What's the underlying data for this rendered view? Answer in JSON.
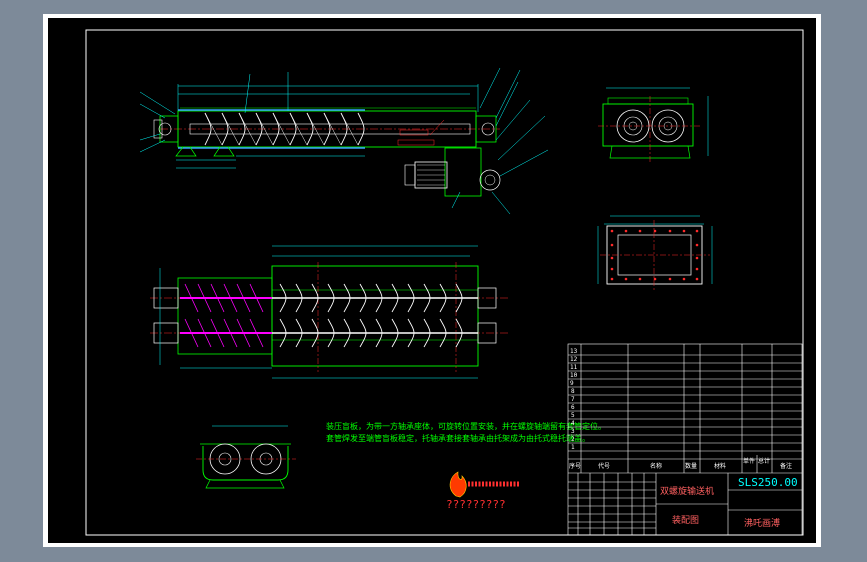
{
  "drawing": {
    "notes": [
      "装压盲板，为带一方轴承座体，可旋转位置安装，并在螺旋轴端留有套管定位。",
      "套管焊发至端管盲板稳定，托轴承套接套轴承由托架成为由托式稳托端盖。"
    ],
    "logo_caption": "?????????",
    "title_block": {
      "drawing_number": "SLS250.00",
      "product_name": "双螺旋输送机",
      "view_name": "装配图",
      "company": "沸吒画溥",
      "header_cols": [
        "序号",
        "代号",
        "名称",
        "数量",
        "材料",
        "单件",
        "总计",
        "备注"
      ],
      "row_numbers": [
        "13",
        "12",
        "11",
        "10",
        "9",
        "8",
        "7",
        "6",
        "5",
        "4",
        "3",
        "2",
        "1"
      ]
    },
    "colors": {
      "line": "#00ff00",
      "screw": "#ffffff",
      "magenta": "#ff00ff",
      "centerline": "#ff2a2a",
      "dimension": "#00ffff",
      "frame": "#ffffff",
      "background": "#000000"
    }
  }
}
